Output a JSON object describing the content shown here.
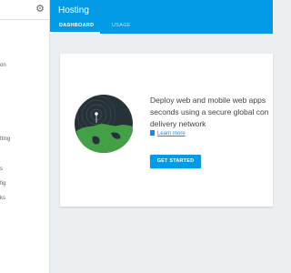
{
  "sidebar": {
    "items": [
      {
        "label": "on"
      },
      {
        "label": "tting"
      },
      {
        "label": "s"
      },
      {
        "label": "fig"
      },
      {
        "label": "ks"
      }
    ]
  },
  "header": {
    "title": "Hosting",
    "tabs": [
      {
        "label": "DASHBOARD"
      },
      {
        "label": "USAGE"
      }
    ]
  },
  "card": {
    "description_lines": [
      "Deploy web and mobile web apps",
      "seconds using a secure global con",
      "delivery network"
    ],
    "learn_more": "Learn more",
    "button": "GET STARTED"
  },
  "icons": {
    "settings": "gear-icon",
    "doc": "doc-icon"
  },
  "colors": {
    "header": "#039be5",
    "button": "#039be5",
    "link": "#1e88e5",
    "globe_bg": "#263238",
    "land": "#43a047"
  }
}
